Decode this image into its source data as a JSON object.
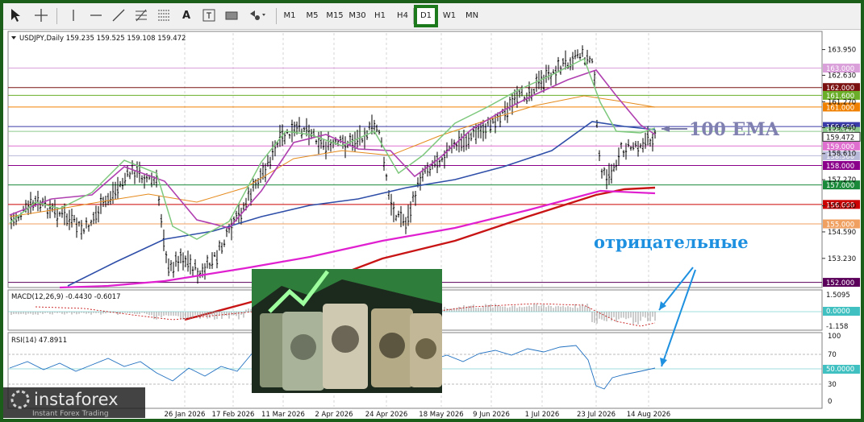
{
  "toolbar": {
    "tools": [
      "cursor-icon",
      "crosshair-icon",
      "vertical-line-icon",
      "horizontal-line-icon",
      "trendline-icon",
      "fibonacci-icon",
      "channel-icon",
      "text-icon",
      "text-label-icon",
      "rectangle-icon",
      "shapes-icon"
    ],
    "text_tool_label": "A",
    "timeframes": [
      "M1",
      "M5",
      "M15",
      "M30",
      "H1",
      "H4",
      "D1",
      "W1",
      "MN"
    ],
    "active_timeframe": "D1"
  },
  "chart_data": {
    "type": "line",
    "symbol_header": "USDJPY,Daily  159.235 159.525 159.108 159.472",
    "price_axis_ticks": [
      "163.950",
      "162.630",
      "161.270",
      "159.940",
      "158.610",
      "157.270",
      "155.930",
      "154.590",
      "153.230"
    ],
    "x_axis_labels": [
      "26 Jan 2026",
      "17 Feb 2026",
      "11 Mar 2026",
      "2 Apr 2026",
      "24 Apr 2026",
      "18 May 2026",
      "9 Jun 2026",
      "1 Jul 2026",
      "23 Jul 2026",
      "14 Aug 2026"
    ],
    "ylim": [
      151.9,
      164.8
    ],
    "horizontal_levels": [
      {
        "label": "163.000",
        "value": 163.0,
        "color": "#d9a0d9"
      },
      {
        "label": "162.000",
        "value": 162.0,
        "color": "#7a1010"
      },
      {
        "label": "161.600",
        "value": 161.6,
        "color": "#6aae2a"
      },
      {
        "label": "161.000",
        "value": 161.0,
        "color": "#f08000"
      },
      {
        "label": "160.000",
        "value": 160.0,
        "color": "#3a3aa8"
      },
      {
        "label": "159.750",
        "value": 159.75,
        "color": "#8dc98d"
      },
      {
        "label": "159.000",
        "value": 159.0,
        "color": "#e070d0"
      },
      {
        "label": "158.500",
        "value": 158.5,
        "color": "#b8b8d8"
      },
      {
        "label": "158.000",
        "value": 158.0,
        "color": "#8a008a"
      },
      {
        "label": "157.000",
        "value": 157.0,
        "color": "#1a8a3a"
      },
      {
        "label": "156.000",
        "value": 156.0,
        "color": "#cc0000"
      },
      {
        "label": "155.000",
        "value": 155.0,
        "color": "#f0a060"
      },
      {
        "label": "152.000",
        "value": 152.0,
        "color": "#5a005a"
      }
    ],
    "current_price_label": "159.472",
    "current_price": 159.472,
    "annotations": {
      "ema_label": "100 EMA",
      "negative_label": "отрицательные"
    },
    "macd": {
      "header": "MACD(12,26,9) -0.4430 -0.6017",
      "ticks": [
        "1.5095",
        "-1.158"
      ],
      "zero_label": "0.0000"
    },
    "rsi": {
      "header": "RSI(14) 47.8911",
      "ticks": [
        "100",
        "70",
        "30",
        "0"
      ],
      "level_label": "50.0000"
    },
    "watermark": {
      "brand": "instaforex",
      "tagline": "Instant Forex Trading"
    }
  }
}
